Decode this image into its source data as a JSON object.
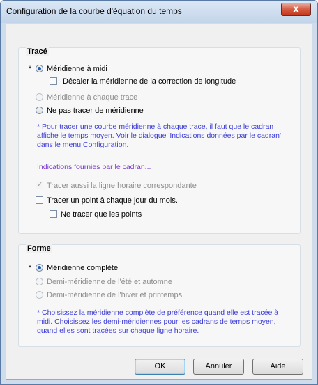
{
  "window": {
    "title": "Configuration de la courbe d'équation du temps",
    "close_glyph": "x"
  },
  "trace_group": {
    "title": "Tracé",
    "midi_marker": "*",
    "midi": "Méridienne à midi",
    "decaler": "Décaler la méridienne de la correction de longitude",
    "chaque_trace": "Méridienne à chaque trace",
    "ne_pas_tracer": "Ne pas tracer de méridienne",
    "note_lines": [
      "* Pour tracer une courbe méridienne à chaque trace, il faut que le cadran",
      "affiche le temps moyen. Voir le dialogue 'Indications données par le cadran'",
      "dans le menu Configuration."
    ],
    "link": "Indications fournies par le cadran...",
    "ligne_horaire": "Tracer aussi la ligne horaire correspondante",
    "point_chaque_jour": "Tracer un point à chaque jour du mois.",
    "que_les_points": "Ne tracer que les points"
  },
  "forme_group": {
    "title": "Forme",
    "complete_marker": "*",
    "complete": "Méridienne complète",
    "ete_automne": "Demi-méridienne de l'été et automne",
    "hiver_printemps": "Demi-méridienne de l'hiver et printemps",
    "note_lines": [
      "* Choisissez la méridienne complète de préférence quand elle est tracée à",
      "midi. Choisissez les demi-méridiennes pour les cadrans de temps moyen,",
      "quand elles sont tracées sur chaque ligne horaire."
    ]
  },
  "buttons": {
    "ok": "OK",
    "annuler": "Annuler",
    "aide": "Aide"
  },
  "colors": {
    "note": "#3b3bd8",
    "link": "#7b3cc9",
    "accent": "#1f5bb7"
  }
}
